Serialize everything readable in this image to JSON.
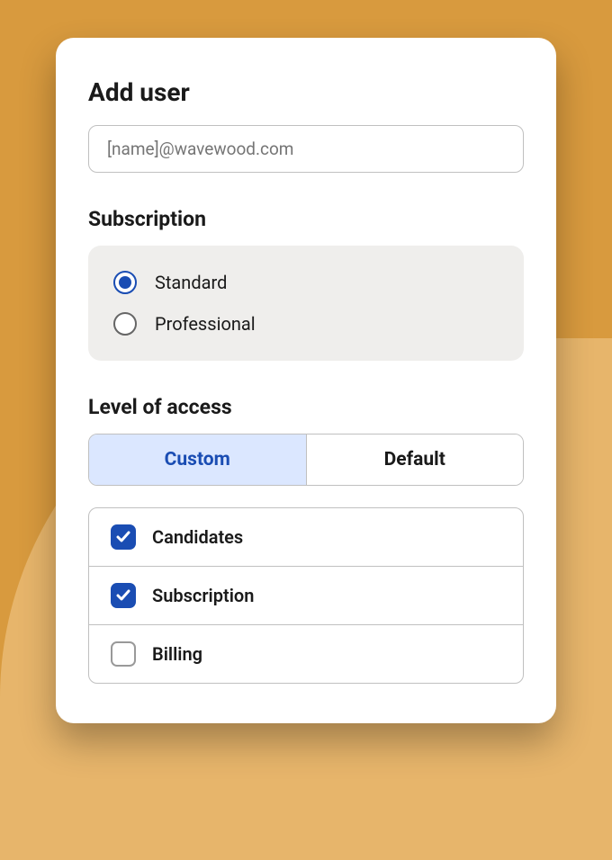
{
  "title": "Add user",
  "email": {
    "placeholder": "[name]@wavewood.com",
    "value": ""
  },
  "subscription": {
    "label": "Subscription",
    "options": [
      {
        "label": "Standard",
        "selected": true
      },
      {
        "label": "Professional",
        "selected": false
      }
    ]
  },
  "access": {
    "label": "Level of access",
    "tabs": [
      {
        "label": "Custom",
        "active": true
      },
      {
        "label": "Default",
        "active": false
      }
    ],
    "permissions": [
      {
        "label": "Candidates",
        "checked": true
      },
      {
        "label": "Subscription",
        "checked": true
      },
      {
        "label": "Billing",
        "checked": false
      }
    ]
  }
}
